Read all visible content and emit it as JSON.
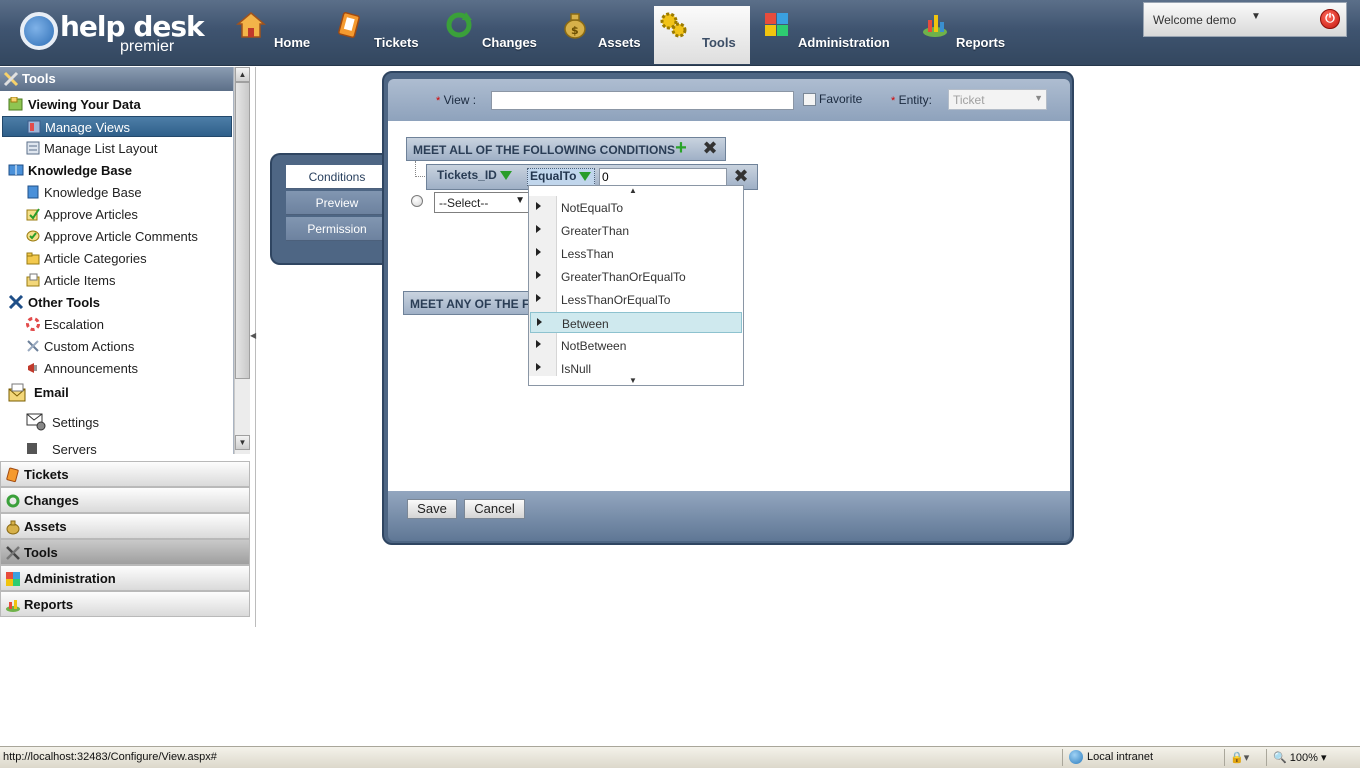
{
  "app": {
    "logo_main": "help desk",
    "logo_sub": "premier"
  },
  "nav": [
    {
      "label": "Home",
      "icon": "house-icon"
    },
    {
      "label": "Tickets",
      "icon": "ticket-icon"
    },
    {
      "label": "Changes",
      "icon": "changes-icon"
    },
    {
      "label": "Assets",
      "icon": "money-bag-icon"
    },
    {
      "label": "Tools",
      "icon": "gears-icon",
      "active": true
    },
    {
      "label": "Administration",
      "icon": "puzzle-icon"
    },
    {
      "label": "Reports",
      "icon": "chart-icon"
    }
  ],
  "user": {
    "welcome": "Welcome demo",
    "caret": "▼",
    "power": "⏻"
  },
  "sidebar": {
    "panel_title": "Tools",
    "groups": [
      {
        "label": "Viewing Your Data",
        "items": [
          "Manage Views",
          "Manage List Layout"
        ]
      },
      {
        "label": "Knowledge Base",
        "items": [
          "Knowledge Base",
          "Approve Articles",
          "Approve Article Comments",
          "Article Categories",
          "Article Items"
        ]
      },
      {
        "label": "Other Tools",
        "items": [
          "Escalation",
          "Custom Actions",
          "Announcements"
        ]
      },
      {
        "label": "Email",
        "items": [
          "Settings",
          "Servers"
        ]
      }
    ],
    "selected_item": "Manage Views",
    "accordion": [
      "Tickets",
      "Changes",
      "Assets",
      "Tools",
      "Administration",
      "Reports"
    ],
    "accordion_active": "Tools"
  },
  "form": {
    "required_mark": "*",
    "view_label": "View :",
    "view_value": "",
    "favorite_label": "Favorite",
    "entity_label": "Entity:",
    "entity_value": "Ticket"
  },
  "tabs": [
    "Conditions",
    "Preview",
    "Permission"
  ],
  "active_tab": "Conditions",
  "conditions": {
    "all_header": "MEET ALL OF THE FOLLOWING CONDITIONS",
    "any_header": "MEET ANY OF THE FOLLOWING CONDITIONS",
    "field": "Tickets_ID",
    "operator": "EqualTo",
    "value": "0",
    "select_placeholder": "--Select--"
  },
  "operator_options": [
    "NotEqualTo",
    "GreaterThan",
    "LessThan",
    "GreaterThanOrEqualTo",
    "LessThanOrEqualTo",
    "Between",
    "NotBetween",
    "IsNull"
  ],
  "operator_highlighted": "Between",
  "buttons": {
    "save": "Save",
    "cancel": "Cancel"
  },
  "status": {
    "url": "http://localhost:32483/Configure/View.aspx#",
    "zone": "Local intranet",
    "zoom": "100%"
  },
  "colors": {
    "nav_bar": "#3f5470",
    "panel_frame": "#4e6684",
    "selected_item": "#2f5f8a",
    "highlight": "#cfe9ee"
  }
}
